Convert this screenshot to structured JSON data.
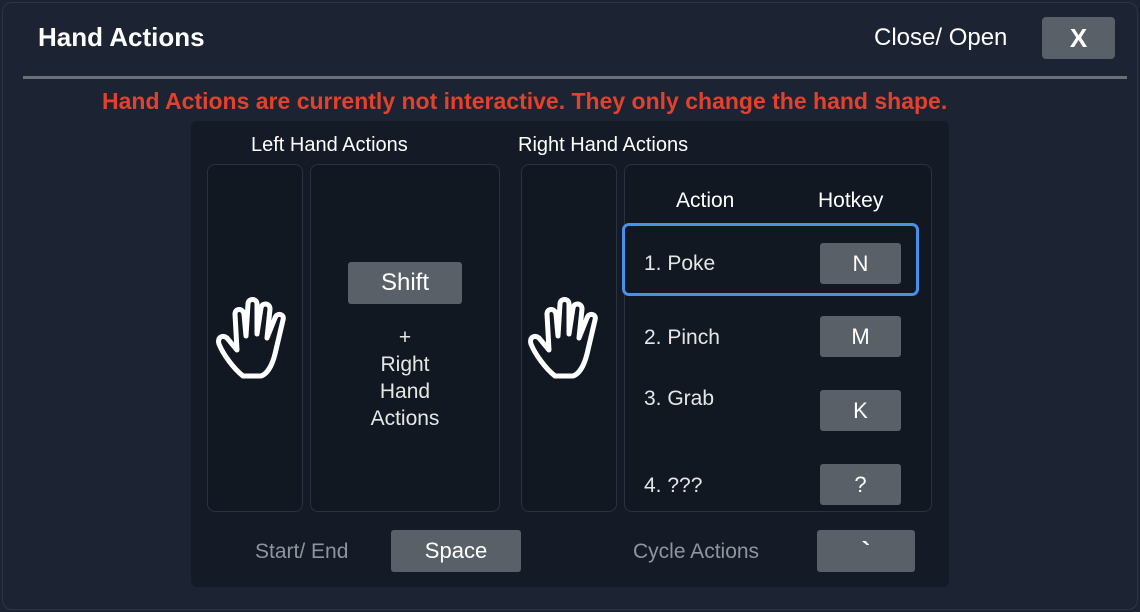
{
  "header": {
    "title": "Hand Actions",
    "close_label": "Close/ Open",
    "close_button": "X"
  },
  "warning": "Hand Actions are currently not interactive. They only change the hand shape.",
  "left": {
    "heading": "Left Hand Actions",
    "modifier_key": "Shift",
    "combo_plus": "+",
    "combo_line1": "Right",
    "combo_line2": "Hand",
    "combo_line3": "Actions"
  },
  "right": {
    "heading": "Right Hand Actions",
    "col_action": "Action",
    "col_hotkey": "Hotkey",
    "actions": [
      {
        "label": "1. Poke",
        "key": "N",
        "selected": true
      },
      {
        "label": "2. Pinch",
        "key": "M"
      },
      {
        "label": "3. Grab",
        "key": "K"
      },
      {
        "label": "4. ???",
        "key": "?"
      }
    ]
  },
  "bottom": {
    "start_end_label": "Start/ End",
    "start_end_key": "Space",
    "cycle_label": "Cycle Actions",
    "cycle_key": "`"
  },
  "icons": {
    "left_hand": "open-hand-icon",
    "right_hand": "open-hand-icon"
  },
  "colors": {
    "background": "#1c2433",
    "warning": "#e3412c",
    "selection": "#4a8fe8",
    "key": "#5a6068"
  }
}
